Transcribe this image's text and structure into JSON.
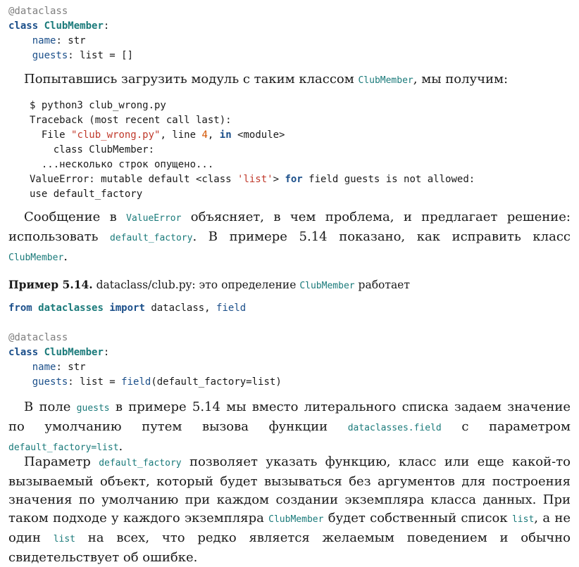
{
  "code1": {
    "decorator": "@dataclass",
    "kw_class": "class",
    "class_name": "ClubMember",
    "colon": ":",
    "name_attr": "name",
    "name_type": ": str",
    "guests_attr": "guests",
    "guests_type": ": list = []"
  },
  "para1": {
    "before": "Попытавшись загрузить модуль с таким классом ",
    "code": "ClubMember",
    "after": ", мы получим:"
  },
  "console": {
    "line1": "$ python3 club_wrong.py",
    "line2": "Traceback (most recent call last):",
    "line3_a": "  File ",
    "line3_str": "\"club_wrong.py\"",
    "line3_b": ", line ",
    "line3_num": "4",
    "line3_c": ", ",
    "line3_kw": "in",
    "line3_d": " <module>",
    "line4": "    class ClubMember:",
    "line5": "  ...несколько строк опущено...",
    "line6_a": "ValueError: mutable default <class ",
    "line6_str": "'list'",
    "line6_b": "> ",
    "line6_kw": "for",
    "line6_c": " field guests is not allowed:",
    "line7": "use default_factory"
  },
  "para2": {
    "t1": "Сообщение в ",
    "c1": "ValueError",
    "t2": " объясняет, в чем проблема, и предлагает решение: использовать ",
    "c2": "default_factory",
    "t3": ". В примере 5.14 показано, как исправить класс ",
    "c3": "ClubMember",
    "t4": "."
  },
  "caption": {
    "label": "Пример 5.14.",
    "t1": " dataclass/club.py: это определение ",
    "code": "ClubMember",
    "t2": " работает"
  },
  "code2": {
    "kw_from": "from",
    "module": "dataclasses",
    "kw_import": "import",
    "names": " dataclass, ",
    "field": "field",
    "decorator": "@dataclass",
    "kw_class": "class",
    "class_name": "ClubMember",
    "colon": ":",
    "name_attr": "name",
    "name_type": ": str",
    "guests_attr": "guests",
    "guests_mid": ": list = ",
    "guests_field": "field",
    "guests_end": "(default_factory=list)"
  },
  "para3": {
    "t1": "В поле ",
    "c1": "guests",
    "t2": " в примере 5.14 мы вместо литерального списка задаем значение по умолчанию путем вызова функции ",
    "c2": "dataclasses.field",
    "t3": " с параметром ",
    "c3": "default_factory=list",
    "t4": "."
  },
  "para4": {
    "t1": "Параметр ",
    "c1": "default_factory",
    "t2": " позволяет указать функцию, класс или еще какой-то вызываемый объект, который будет вызываться без аргументов для построения значения по умолчанию при каждом создании экземпляра класса данных. При таком подходе у каждого экземпляра ",
    "c2": "ClubMember",
    "t3": " будет собственный список ",
    "c3": "list",
    "t4": ", а не один ",
    "c4": "list",
    "t5": " на всех, что редко является желаемым поведением и обычно свидетельствует об ошибке."
  }
}
